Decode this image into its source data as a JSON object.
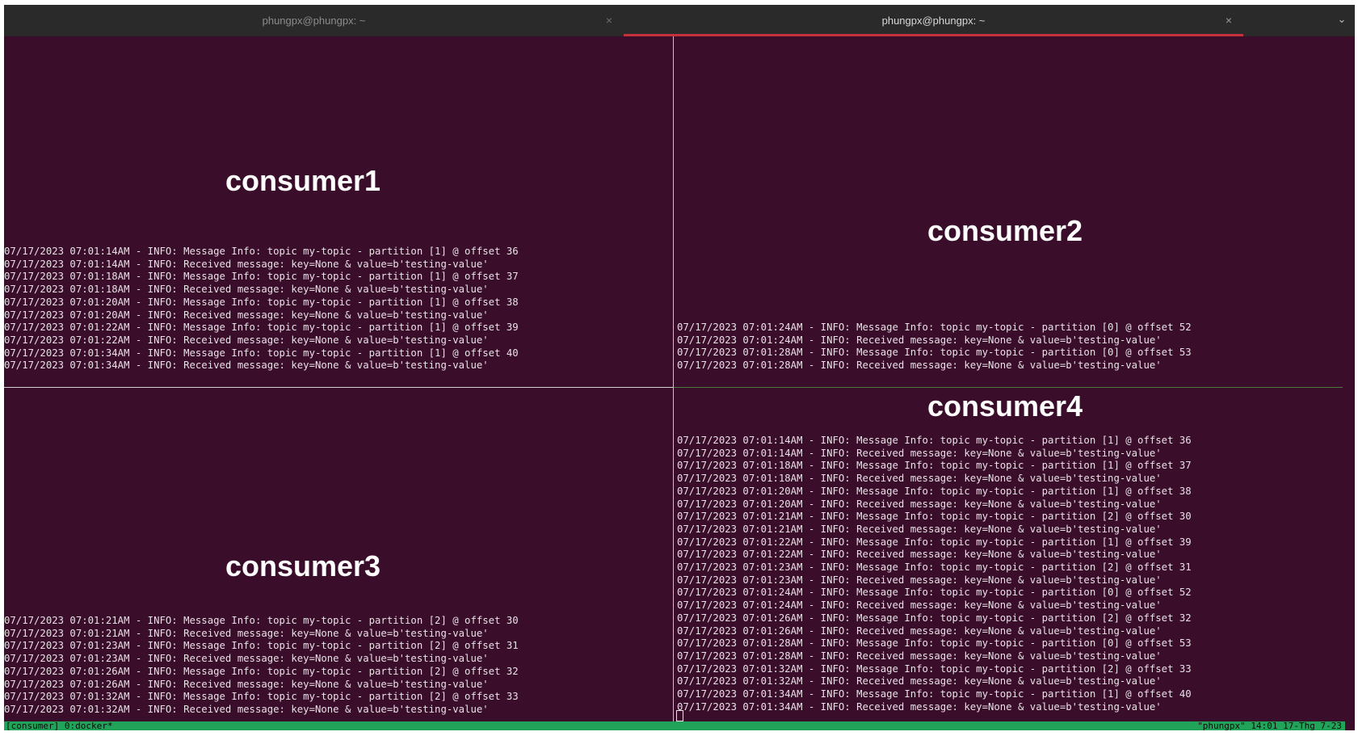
{
  "tabs": [
    {
      "title": "phungpx@phungpx: ~",
      "active": false
    },
    {
      "title": "phungpx@phungpx: ~",
      "active": true
    }
  ],
  "tab_close_glyph": "×",
  "tab_menu_glyph": "⌄",
  "panes": {
    "consumer1": {
      "label": "consumer1",
      "lines": [
        "07/17/2023 07:01:14AM - INFO: Message Info: topic my-topic - partition [1] @ offset 36",
        "07/17/2023 07:01:14AM - INFO: Received message: key=None & value=b'testing-value'",
        "07/17/2023 07:01:18AM - INFO: Message Info: topic my-topic - partition [1] @ offset 37",
        "07/17/2023 07:01:18AM - INFO: Received message: key=None & value=b'testing-value'",
        "07/17/2023 07:01:20AM - INFO: Message Info: topic my-topic - partition [1] @ offset 38",
        "07/17/2023 07:01:20AM - INFO: Received message: key=None & value=b'testing-value'",
        "07/17/2023 07:01:22AM - INFO: Message Info: topic my-topic - partition [1] @ offset 39",
        "07/17/2023 07:01:22AM - INFO: Received message: key=None & value=b'testing-value'",
        "07/17/2023 07:01:34AM - INFO: Message Info: topic my-topic - partition [1] @ offset 40",
        "07/17/2023 07:01:34AM - INFO: Received message: key=None & value=b'testing-value'"
      ]
    },
    "consumer2": {
      "label": "consumer2",
      "lines": [
        "07/17/2023 07:01:24AM - INFO: Message Info: topic my-topic - partition [0] @ offset 52",
        "07/17/2023 07:01:24AM - INFO: Received message: key=None & value=b'testing-value'",
        "07/17/2023 07:01:28AM - INFO: Message Info: topic my-topic - partition [0] @ offset 53",
        "07/17/2023 07:01:28AM - INFO: Received message: key=None & value=b'testing-value'"
      ]
    },
    "consumer3": {
      "label": "consumer3",
      "lines": [
        "07/17/2023 07:01:21AM - INFO: Message Info: topic my-topic - partition [2] @ offset 30",
        "07/17/2023 07:01:21AM - INFO: Received message: key=None & value=b'testing-value'",
        "07/17/2023 07:01:23AM - INFO: Message Info: topic my-topic - partition [2] @ offset 31",
        "07/17/2023 07:01:23AM - INFO: Received message: key=None & value=b'testing-value'",
        "07/17/2023 07:01:26AM - INFO: Message Info: topic my-topic - partition [2] @ offset 32",
        "07/17/2023 07:01:26AM - INFO: Received message: key=None & value=b'testing-value'",
        "07/17/2023 07:01:32AM - INFO: Message Info: topic my-topic - partition [2] @ offset 33",
        "07/17/2023 07:01:32AM - INFO: Received message: key=None & value=b'testing-value'"
      ]
    },
    "consumer4": {
      "label": "consumer4",
      "lines": [
        "07/17/2023 07:01:14AM - INFO: Message Info: topic my-topic - partition [1] @ offset 36",
        "07/17/2023 07:01:14AM - INFO: Received message: key=None & value=b'testing-value'",
        "07/17/2023 07:01:18AM - INFO: Message Info: topic my-topic - partition [1] @ offset 37",
        "07/17/2023 07:01:18AM - INFO: Received message: key=None & value=b'testing-value'",
        "07/17/2023 07:01:20AM - INFO: Message Info: topic my-topic - partition [1] @ offset 38",
        "07/17/2023 07:01:20AM - INFO: Received message: key=None & value=b'testing-value'",
        "07/17/2023 07:01:21AM - INFO: Message Info: topic my-topic - partition [2] @ offset 30",
        "07/17/2023 07:01:21AM - INFO: Received message: key=None & value=b'testing-value'",
        "07/17/2023 07:01:22AM - INFO: Message Info: topic my-topic - partition [1] @ offset 39",
        "07/17/2023 07:01:22AM - INFO: Received message: key=None & value=b'testing-value'",
        "07/17/2023 07:01:23AM - INFO: Message Info: topic my-topic - partition [2] @ offset 31",
        "07/17/2023 07:01:23AM - INFO: Received message: key=None & value=b'testing-value'",
        "07/17/2023 07:01:24AM - INFO: Message Info: topic my-topic - partition [0] @ offset 52",
        "07/17/2023 07:01:24AM - INFO: Received message: key=None & value=b'testing-value'",
        "07/17/2023 07:01:26AM - INFO: Message Info: topic my-topic - partition [2] @ offset 32",
        "07/17/2023 07:01:26AM - INFO: Received message: key=None & value=b'testing-value'",
        "07/17/2023 07:01:28AM - INFO: Message Info: topic my-topic - partition [0] @ offset 53",
        "07/17/2023 07:01:28AM - INFO: Received message: key=None & value=b'testing-value'",
        "07/17/2023 07:01:32AM - INFO: Message Info: topic my-topic - partition [2] @ offset 33",
        "07/17/2023 07:01:32AM - INFO: Received message: key=None & value=b'testing-value'",
        "07/17/2023 07:01:34AM - INFO: Message Info: topic my-topic - partition [1] @ offset 40",
        "07/17/2023 07:01:34AM - INFO: Received message: key=None & value=b'testing-value'"
      ]
    }
  },
  "status_bar": {
    "left": "[consumer] 0:docker*",
    "right": "\"phungpx\" 14:01 17-Thg 7-23"
  },
  "colors": {
    "terminal_bg": "#3a0d2b",
    "terminal_fg": "#e9e1e6",
    "status_bg": "#22a35a",
    "tab_active_underline": "#c7313d"
  }
}
